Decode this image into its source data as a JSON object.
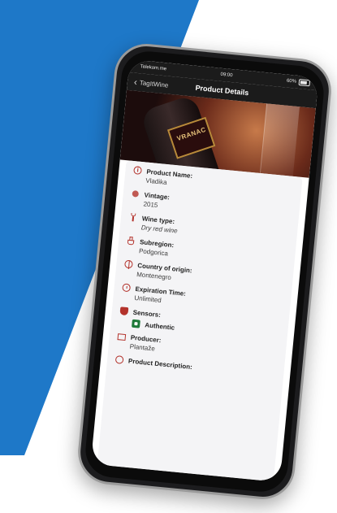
{
  "statusbar": {
    "carrier": "Telekom.me",
    "time": "09:00",
    "battery": "60%"
  },
  "navbar": {
    "back_label": "TagItWine",
    "title": "Product Details"
  },
  "hero": {
    "label_text": "VRANAC"
  },
  "details": {
    "product_name": {
      "title": "Product Name:",
      "value": "Vladika"
    },
    "vintage": {
      "title": "Vintage:",
      "value": "2015"
    },
    "wine_type": {
      "title": "Wine type:",
      "value": "Dry red wine"
    },
    "subregion": {
      "title": "Subregion:",
      "value": "Podgorica"
    },
    "country": {
      "title": "Country of origin:",
      "value": "Montenegro"
    },
    "expiration": {
      "title": "Expiration Time:",
      "value": "Unlimited"
    },
    "sensors": {
      "title": "Sensors:",
      "status": "Authentic"
    },
    "producer": {
      "title": "Producer:",
      "value": "Plantaže"
    },
    "product_description": {
      "title": "Product Description:"
    }
  },
  "colors": {
    "accent": "#b3322b",
    "bg_blue": "#1e78c8",
    "phone_frame": "#1c1c1e"
  },
  "icons": {
    "back": "chevron-left-icon",
    "info": "info-icon",
    "vintage": "grape-icon",
    "wine_type": "wine-glass-icon",
    "subregion": "flask-icon",
    "country": "globe-icon",
    "expiration": "clock-icon",
    "sensors": "shield-icon",
    "authentic": "chip-icon",
    "producer": "factory-icon"
  }
}
